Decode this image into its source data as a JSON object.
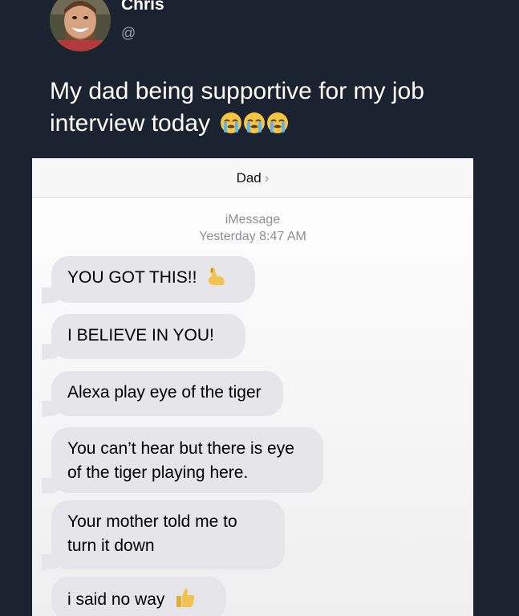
{
  "post": {
    "author_name": "Chris",
    "author_handle": "@",
    "text": "My dad being supportive for my job interview today",
    "emojis": [
      "loudly-crying-face",
      "loudly-crying-face",
      "loudly-crying-face"
    ]
  },
  "messages_screen": {
    "contact_name": "Dad",
    "service": "iMessage",
    "timestamp": "Yesterday 8:47 AM",
    "messages": [
      {
        "text": "YOU GOT THIS!!",
        "emoji": "flexed-biceps"
      },
      {
        "text": "I BELIEVE IN YOU!"
      },
      {
        "text": "Alexa play eye of the tiger"
      },
      {
        "text": "You can’t hear but there is eye of the tiger playing here."
      },
      {
        "text": "Your mother told me to turn it down"
      },
      {
        "text": "i said no way",
        "emoji": "thumbs-up"
      }
    ]
  },
  "colors": {
    "page_background": "#1b2230",
    "bubble_incoming": "#e5e5ea",
    "meta_text": "#8e8e93"
  }
}
